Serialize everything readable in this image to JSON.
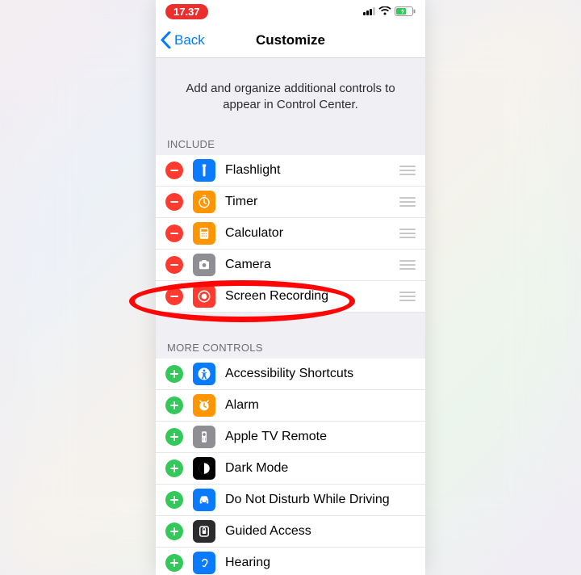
{
  "statusbar": {
    "time": "17.37"
  },
  "nav": {
    "back": "Back",
    "title": "Customize"
  },
  "header_text": "Add and organize additional controls to appear in Control Center.",
  "sections": {
    "include": {
      "title": "Include",
      "items": [
        {
          "label": "Flashlight"
        },
        {
          "label": "Timer"
        },
        {
          "label": "Calculator"
        },
        {
          "label": "Camera"
        },
        {
          "label": "Screen Recording"
        }
      ]
    },
    "more": {
      "title": "More Controls",
      "items": [
        {
          "label": "Accessibility Shortcuts"
        },
        {
          "label": "Alarm"
        },
        {
          "label": "Apple TV Remote"
        },
        {
          "label": "Dark Mode"
        },
        {
          "label": "Do Not Disturb While Driving"
        },
        {
          "label": "Guided Access"
        },
        {
          "label": "Hearing"
        }
      ]
    }
  },
  "annotation": {
    "highlighted_item": "Screen Recording"
  }
}
